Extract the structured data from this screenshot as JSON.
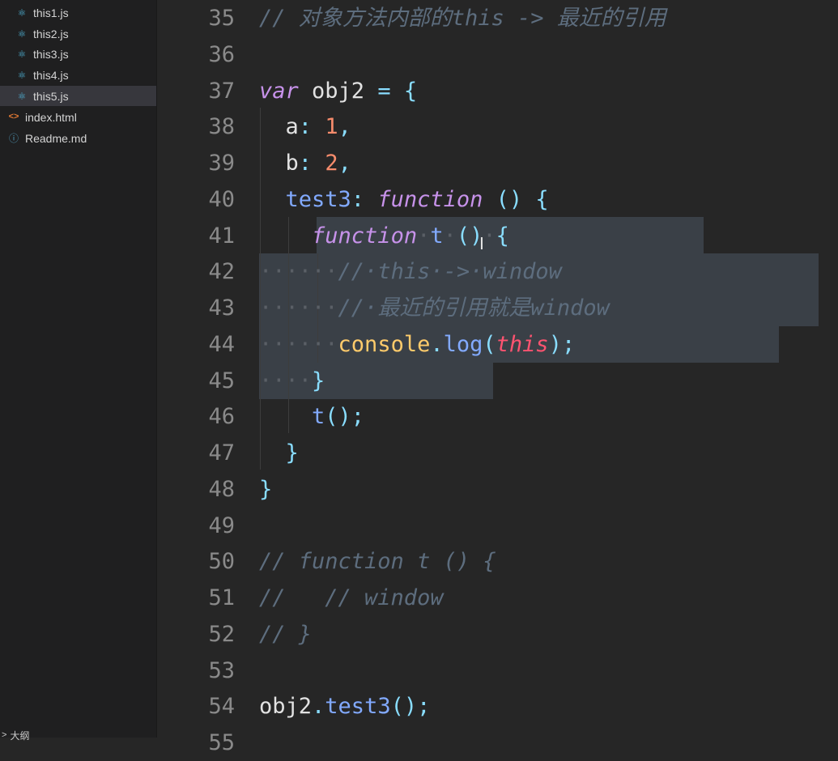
{
  "sidebar": {
    "files": [
      {
        "name": "this1.js",
        "icon": "react-icon"
      },
      {
        "name": "this2.js",
        "icon": "react-icon"
      },
      {
        "name": "this3.js",
        "icon": "react-icon"
      },
      {
        "name": "this4.js",
        "icon": "react-icon"
      },
      {
        "name": "this5.js",
        "icon": "react-icon",
        "selected": true
      },
      {
        "name": "index.html",
        "icon": "html-icon"
      },
      {
        "name": "Readme.md",
        "icon": "info-icon"
      }
    ],
    "outline_label": "大纲"
  },
  "editor": {
    "lines": [
      {
        "n": "35",
        "tokens": [
          {
            "t": "// 对象方法内部的this -> 最近的引用",
            "c": "cm"
          }
        ]
      },
      {
        "n": "36",
        "tokens": []
      },
      {
        "n": "37",
        "tokens": [
          {
            "t": "var",
            "c": "kw"
          },
          {
            "t": " obj2 ",
            "c": ""
          },
          {
            "t": "=",
            "c": "pn"
          },
          {
            "t": " ",
            "c": ""
          },
          {
            "t": "{",
            "c": "pn"
          }
        ]
      },
      {
        "n": "38",
        "tokens": [
          {
            "t": "  a",
            "c": ""
          },
          {
            "t": ":",
            "c": "pn"
          },
          {
            "t": " ",
            "c": ""
          },
          {
            "t": "1",
            "c": "num"
          },
          {
            "t": ",",
            "c": "pn"
          }
        ]
      },
      {
        "n": "39",
        "tokens": [
          {
            "t": "  b",
            "c": ""
          },
          {
            "t": ":",
            "c": "pn"
          },
          {
            "t": " ",
            "c": ""
          },
          {
            "t": "2",
            "c": "num"
          },
          {
            "t": ",",
            "c": "pn"
          }
        ]
      },
      {
        "n": "40",
        "tokens": [
          {
            "t": "  ",
            "c": ""
          },
          {
            "t": "test3",
            "c": "fn"
          },
          {
            "t": ":",
            "c": "pn"
          },
          {
            "t": " ",
            "c": ""
          },
          {
            "t": "function",
            "c": "kw"
          },
          {
            "t": " ",
            "c": ""
          },
          {
            "t": "()",
            "c": "pn"
          },
          {
            "t": " ",
            "c": ""
          },
          {
            "t": "{",
            "c": "pn"
          }
        ]
      },
      {
        "n": "41",
        "tokens": [
          {
            "t": "    ",
            "c": ""
          },
          {
            "t": "function",
            "c": "kw"
          },
          {
            "t": "·",
            "c": "ws"
          },
          {
            "t": "t",
            "c": "fn"
          },
          {
            "t": "·",
            "c": "ws"
          },
          {
            "t": "()",
            "c": "pn"
          },
          {
            "t": "·",
            "c": "ws"
          },
          {
            "t": "{",
            "c": "pn"
          }
        ]
      },
      {
        "n": "42",
        "tokens": [
          {
            "t": "······",
            "c": "ws"
          },
          {
            "t": "//·this·->·window",
            "c": "cm"
          }
        ]
      },
      {
        "n": "43",
        "tokens": [
          {
            "t": "······",
            "c": "ws"
          },
          {
            "t": "//·最近的引用就是window",
            "c": "cm"
          }
        ]
      },
      {
        "n": "44",
        "tokens": [
          {
            "t": "······",
            "c": "ws"
          },
          {
            "t": "console",
            "c": "obj"
          },
          {
            "t": ".",
            "c": "pn"
          },
          {
            "t": "log",
            "c": "fn"
          },
          {
            "t": "(",
            "c": "pn"
          },
          {
            "t": "this",
            "c": "th"
          },
          {
            "t": ");",
            "c": "pn"
          }
        ]
      },
      {
        "n": "45",
        "tokens": [
          {
            "t": "····",
            "c": "ws"
          },
          {
            "t": "}",
            "c": "pn"
          }
        ]
      },
      {
        "n": "46",
        "tokens": [
          {
            "t": "    ",
            "c": ""
          },
          {
            "t": "t",
            "c": "fn"
          },
          {
            "t": "();",
            "c": "pn"
          }
        ]
      },
      {
        "n": "47",
        "tokens": [
          {
            "t": "  ",
            "c": ""
          },
          {
            "t": "}",
            "c": "pn"
          }
        ]
      },
      {
        "n": "48",
        "tokens": [
          {
            "t": "}",
            "c": "pn"
          }
        ]
      },
      {
        "n": "49",
        "tokens": []
      },
      {
        "n": "50",
        "tokens": [
          {
            "t": "// function t () {",
            "c": "cm"
          }
        ]
      },
      {
        "n": "51",
        "tokens": [
          {
            "t": "//   // window",
            "c": "cm"
          }
        ]
      },
      {
        "n": "52",
        "tokens": [
          {
            "t": "// }",
            "c": "cm"
          }
        ]
      },
      {
        "n": "53",
        "tokens": []
      },
      {
        "n": "54",
        "tokens": [
          {
            "t": "obj2",
            "c": ""
          },
          {
            "t": ".",
            "c": "pn"
          },
          {
            "t": "test3",
            "c": "fn"
          },
          {
            "t": "();",
            "c": "pn"
          }
        ]
      },
      {
        "n": "55",
        "tokens": []
      }
    ]
  },
  "colors": {
    "background": "#262626",
    "sidebar": "#1f1f20",
    "selection": "#3a4047",
    "keyword": "#c792ea",
    "number": "#f78c6c",
    "function": "#82aaff",
    "comment": "#5d6d7e",
    "this": "#ff5370",
    "console": "#ffcb6b"
  }
}
